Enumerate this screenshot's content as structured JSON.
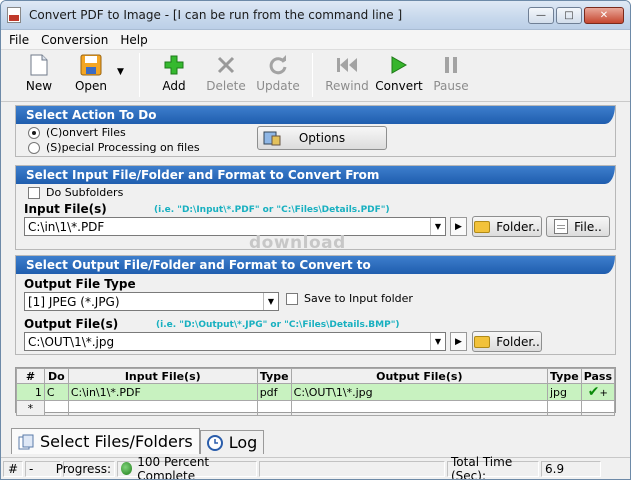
{
  "window": {
    "title": "Convert PDF to Image - [I can be run from the command line ]"
  },
  "menu": [
    "File",
    "Conversion",
    "Help"
  ],
  "toolbar": {
    "new": "New",
    "open": "Open",
    "add": "Add",
    "delete": "Delete",
    "update": "Update",
    "rewind": "Rewind",
    "convert": "Convert",
    "pause": "Pause"
  },
  "action": {
    "header": "Select Action To Do",
    "convert_files": "(C)onvert Files",
    "special": "(S)pecial Processing on files",
    "options_button": "Options",
    "selected": "convert_files"
  },
  "input": {
    "header": "Select Input File/Folder and Format to Convert From",
    "do_subfolders": "Do Subfolders",
    "label": "Input File(s)",
    "hint": "(i.e. \"D:\\Input\\*.PDF\"  or \"C:\\Files\\Details.PDF\")",
    "value": "C:\\in\\1\\*.PDF",
    "folder_button": "Folder..",
    "file_button": "File.."
  },
  "output": {
    "header": "Select Output File/Folder and Format to Convert to",
    "type_label": "Output File Type",
    "type_value": "[1] JPEG (*.JPG)",
    "save_to_input": "Save to Input folder",
    "label": "Output File(s)",
    "hint": "(i.e. \"D:\\Output\\*.JPG\"  or \"C:\\Files\\Details.BMP\")",
    "value": "C:\\OUT\\1\\*.jpg",
    "folder_button": "Folder.."
  },
  "grid": {
    "columns": [
      "#",
      "Do",
      "Input File(s)",
      "Type",
      "Output File(s)",
      "Type",
      "Pass"
    ],
    "rows": [
      {
        "num": "1",
        "do": "C",
        "input": "C:\\in\\1\\*.PDF",
        "type": "pdf",
        "output": "C:\\OUT\\1\\*.jpg",
        "otype": "jpg",
        "pass": "+"
      }
    ],
    "new_row_marker": "*"
  },
  "watermark": "download",
  "tabs": [
    "Select Files/Folders",
    "Log"
  ],
  "status": {
    "hash": "#",
    "dash": "-",
    "progress_label": "Progress:",
    "progress_text": "100 Percent Complete",
    "progress_fraction": 1.0,
    "total_time_label": "Total Time (Sec):",
    "total_time": "6.9"
  }
}
